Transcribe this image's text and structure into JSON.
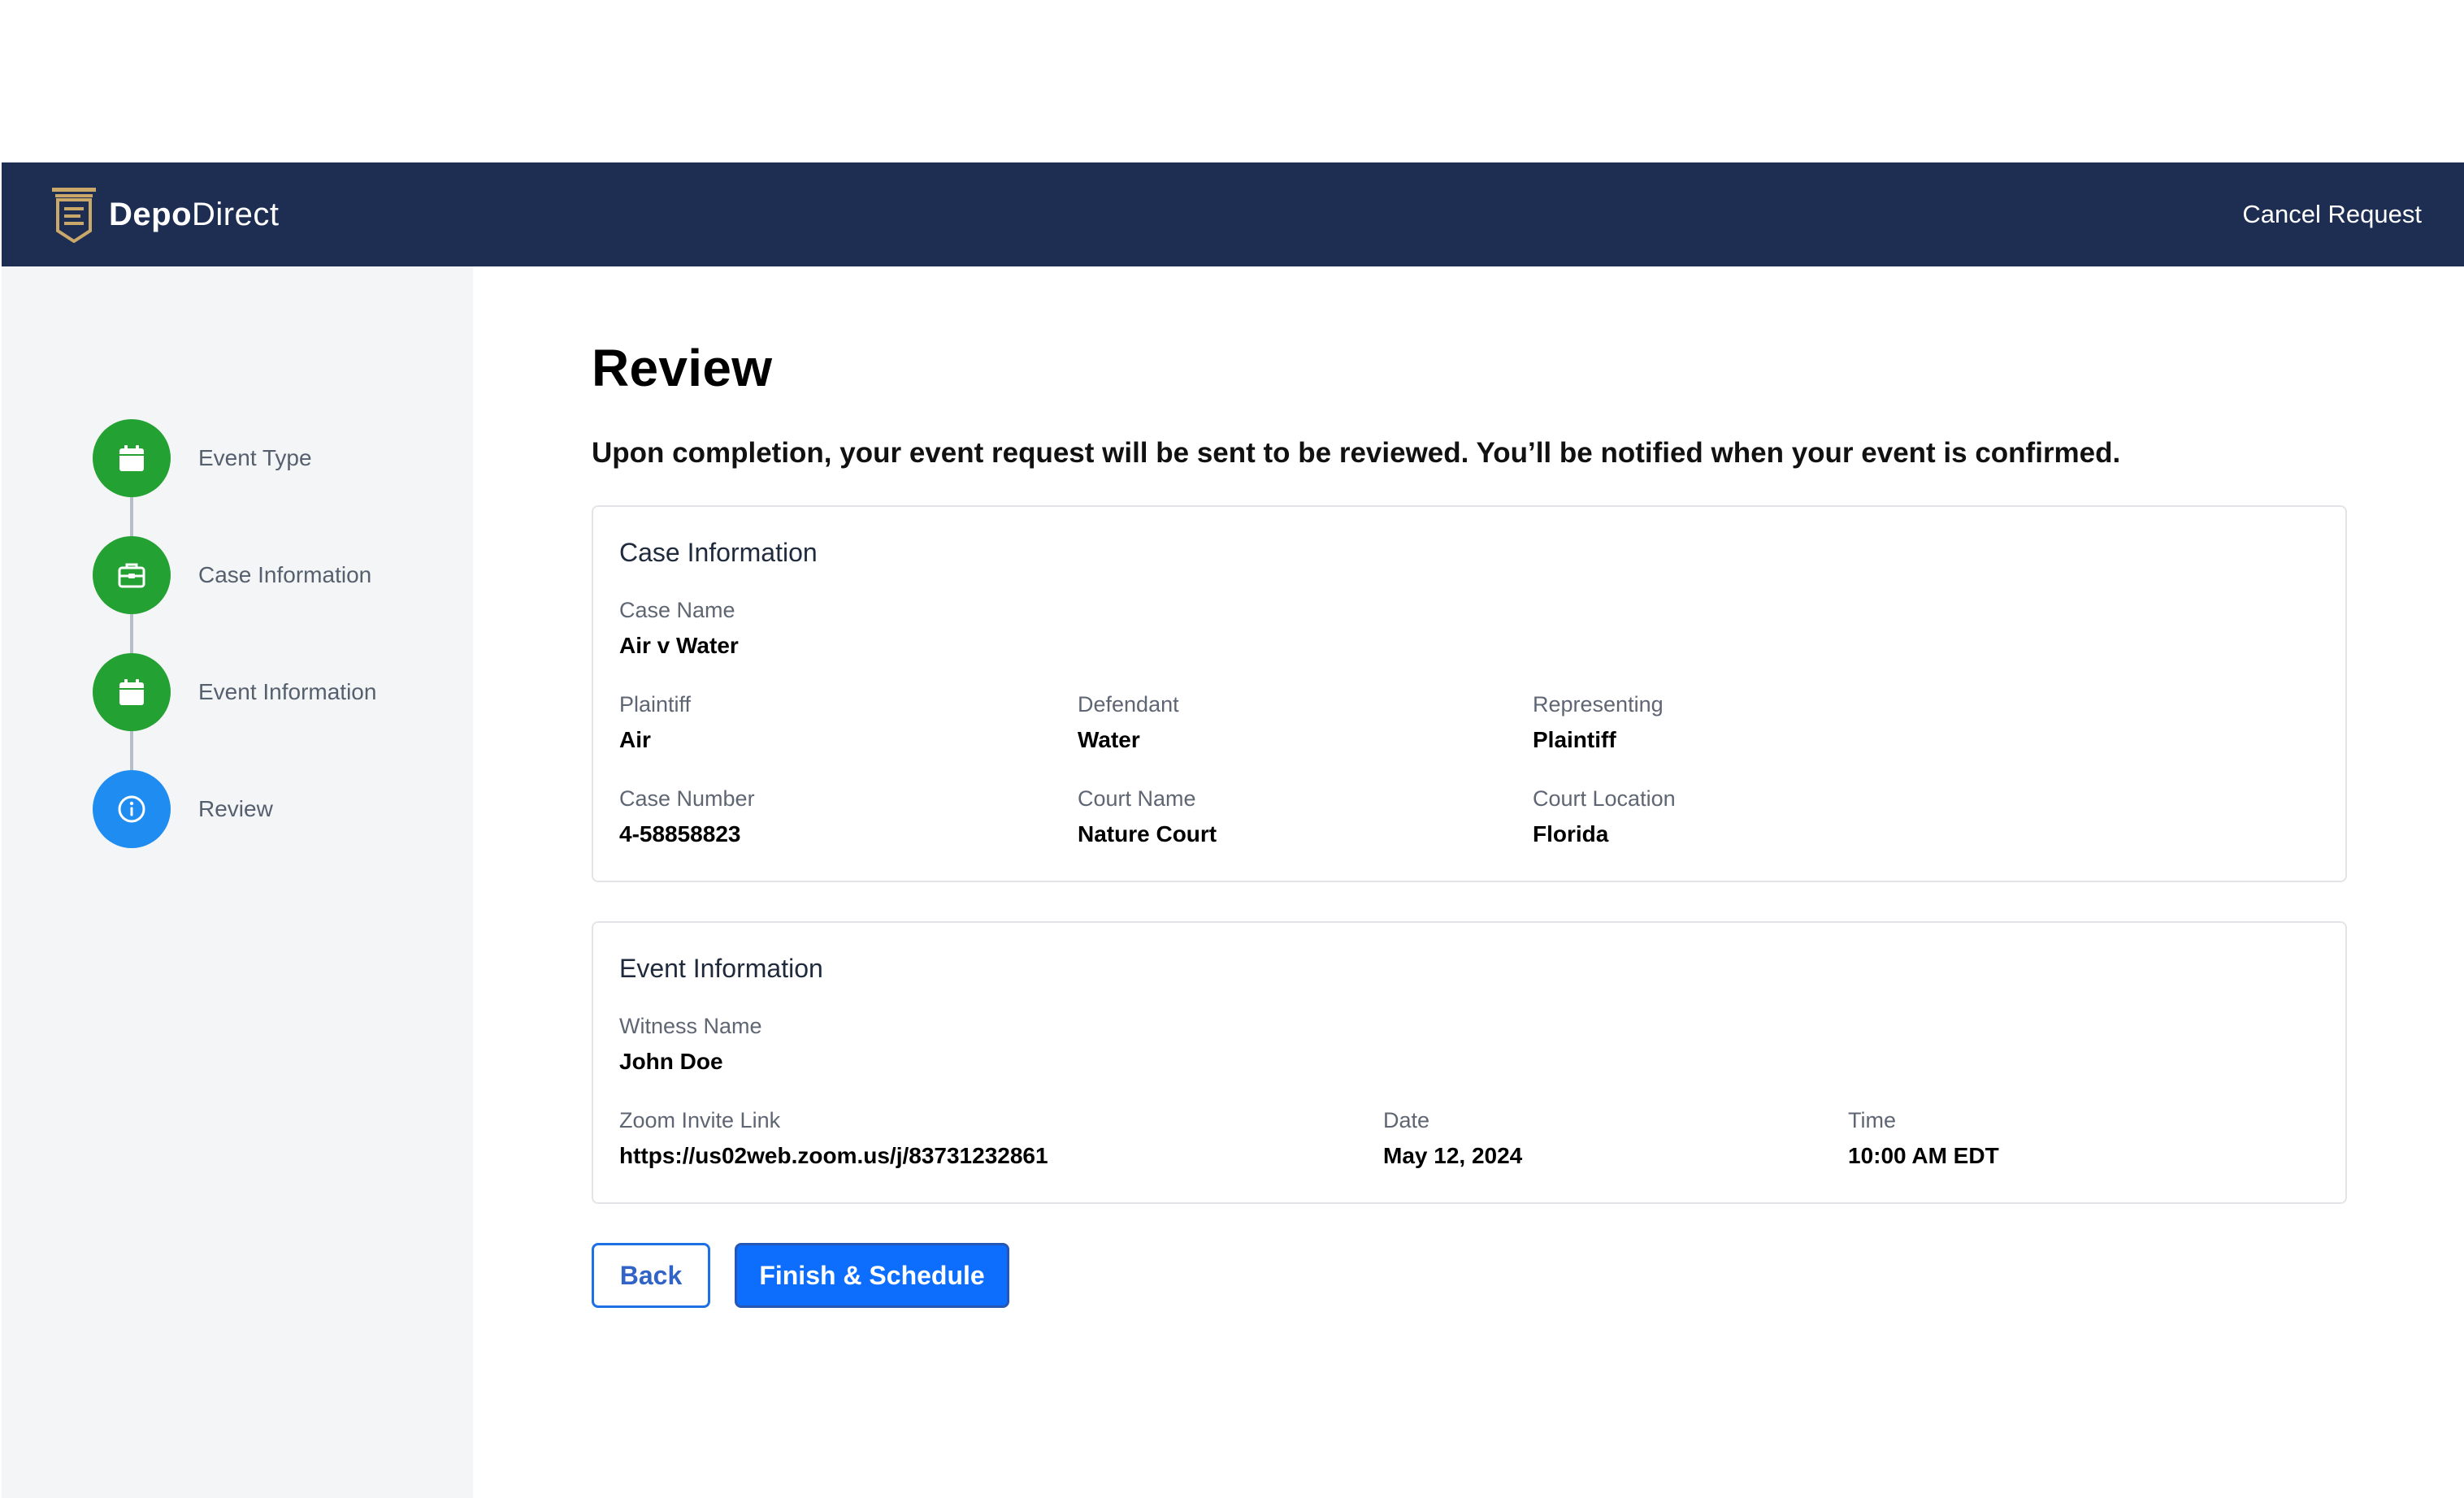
{
  "header": {
    "brand_bold": "Depo",
    "brand_light": "Direct",
    "cancel_label": "Cancel Request"
  },
  "steps": [
    {
      "label": "Event Type",
      "icon": "calendar-icon",
      "state": "complete"
    },
    {
      "label": "Case Information",
      "icon": "briefcase-icon",
      "state": "complete"
    },
    {
      "label": "Event Information",
      "icon": "calendar-icon",
      "state": "complete"
    },
    {
      "label": "Review",
      "icon": "info-icon",
      "state": "active"
    }
  ],
  "page": {
    "title": "Review",
    "subtitle": "Upon completion, your event request will be sent to be reviewed. You’ll be notified when your event is confirmed."
  },
  "case_info": {
    "title": "Case Information",
    "case_name_label": "Case Name",
    "case_name": "Air v Water",
    "plaintiff_label": "Plaintiff",
    "plaintiff": "Air",
    "defendant_label": "Defendant",
    "defendant": "Water",
    "representing_label": "Representing",
    "representing": "Plaintiff",
    "case_number_label": "Case Number",
    "case_number": "4-58858823",
    "court_name_label": "Court Name",
    "court_name": "Nature Court",
    "court_location_label": "Court Location",
    "court_location": "Florida"
  },
  "event_info": {
    "title": "Event Information",
    "witness_label": "Witness Name",
    "witness": "John Doe",
    "zoom_label": "Zoom Invite Link",
    "zoom": "https://us02web.zoom.us/j/83731232861",
    "date_label": "Date",
    "date": "May 12, 2024",
    "time_label": "Time",
    "time": "10:00 AM EDT"
  },
  "actions": {
    "back_label": "Back",
    "finish_label": "Finish & Schedule"
  },
  "colors": {
    "header_bg": "#1e2e52",
    "logo_gold": "#c9a86a",
    "step_complete": "#23a132",
    "step_active": "#1e8cf0",
    "primary": "#0d6efd"
  }
}
